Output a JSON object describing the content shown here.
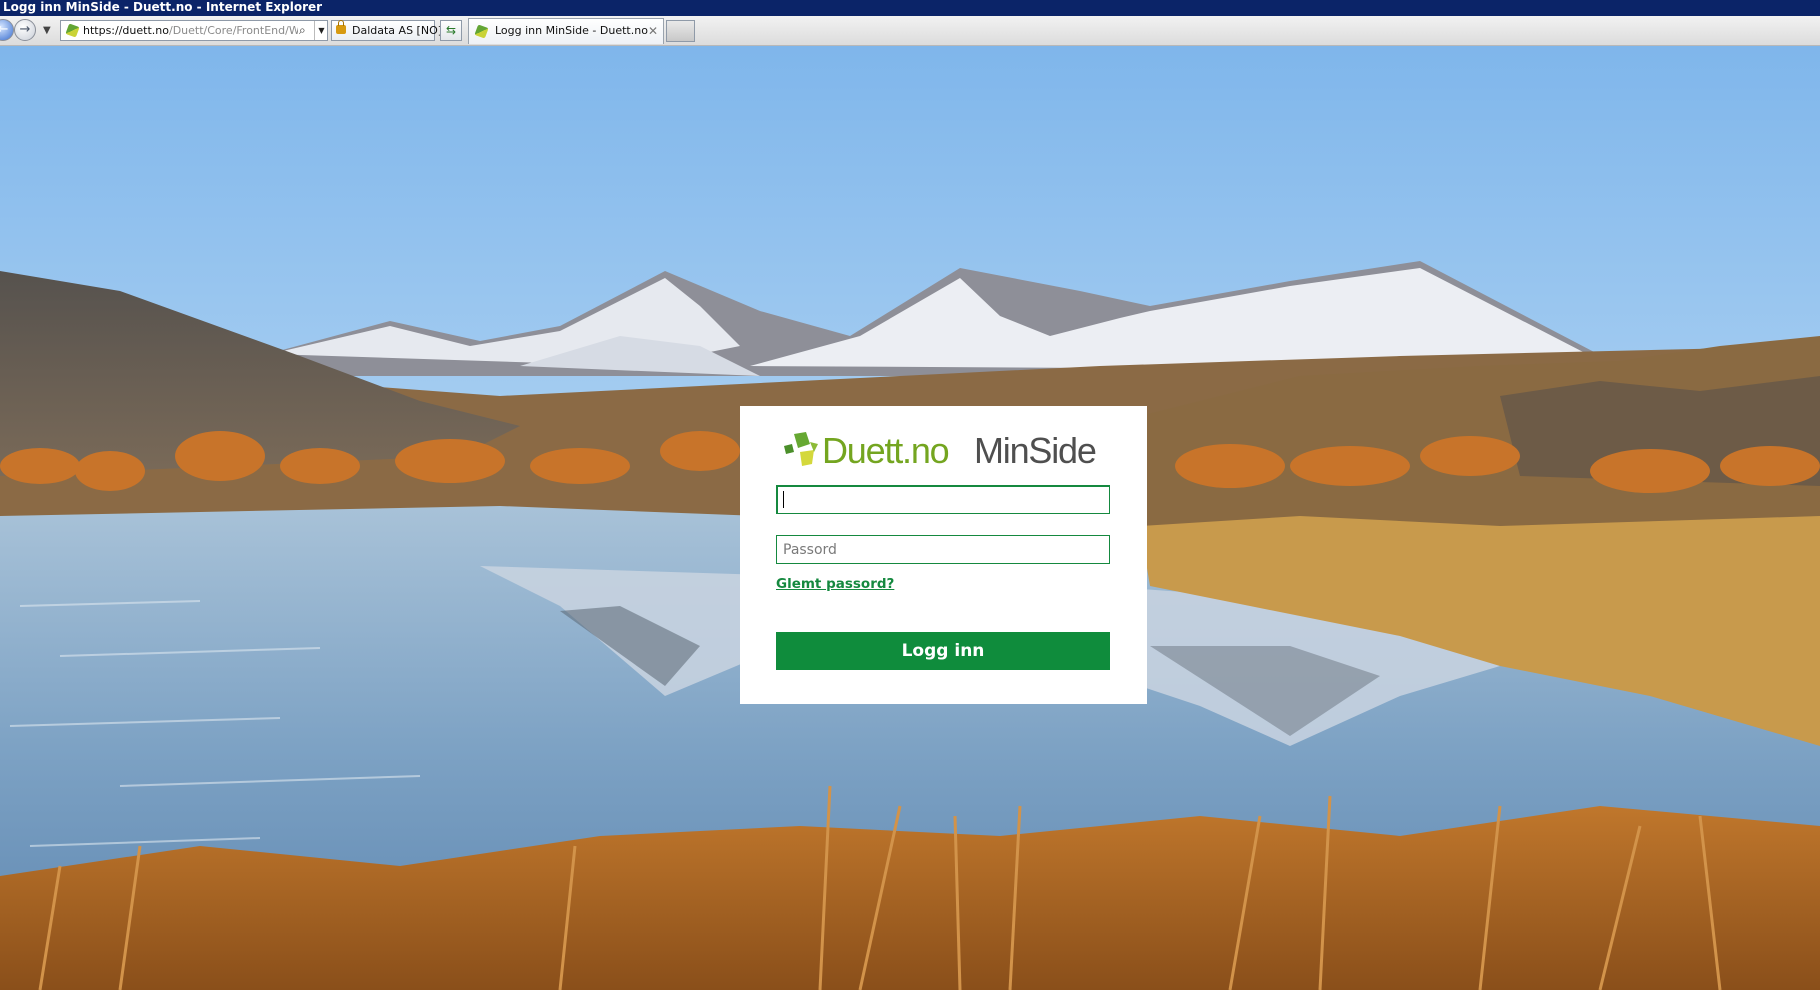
{
  "window": {
    "title": "Logg inn MinSide - Duett.no - Internet Explorer"
  },
  "browser": {
    "url_host": "https://duett.no",
    "url_path": "/Duett/Core/FrontEnd/Web",
    "security_label": "Daldata AS [NO]",
    "tab_title": "Logg inn MinSide - Duett.no",
    "icons": {
      "back": "back-arrow-icon",
      "forward": "forward-arrow-icon",
      "recent": "dropdown-arrow-icon",
      "search": "magnifier-icon",
      "lock": "lock-icon",
      "refresh": "refresh-icon",
      "close": "close-icon"
    }
  },
  "login": {
    "brand_part1": "Duett.no",
    "brand_part2": "MinSide",
    "username_value": "",
    "password_placeholder": "Passord",
    "forgot_label": "Glemt passord?",
    "submit_label": "Logg inn"
  },
  "colors": {
    "brand_green": "#74a520",
    "button_green": "#0f8c3c",
    "title_bar": "#0b2468"
  }
}
